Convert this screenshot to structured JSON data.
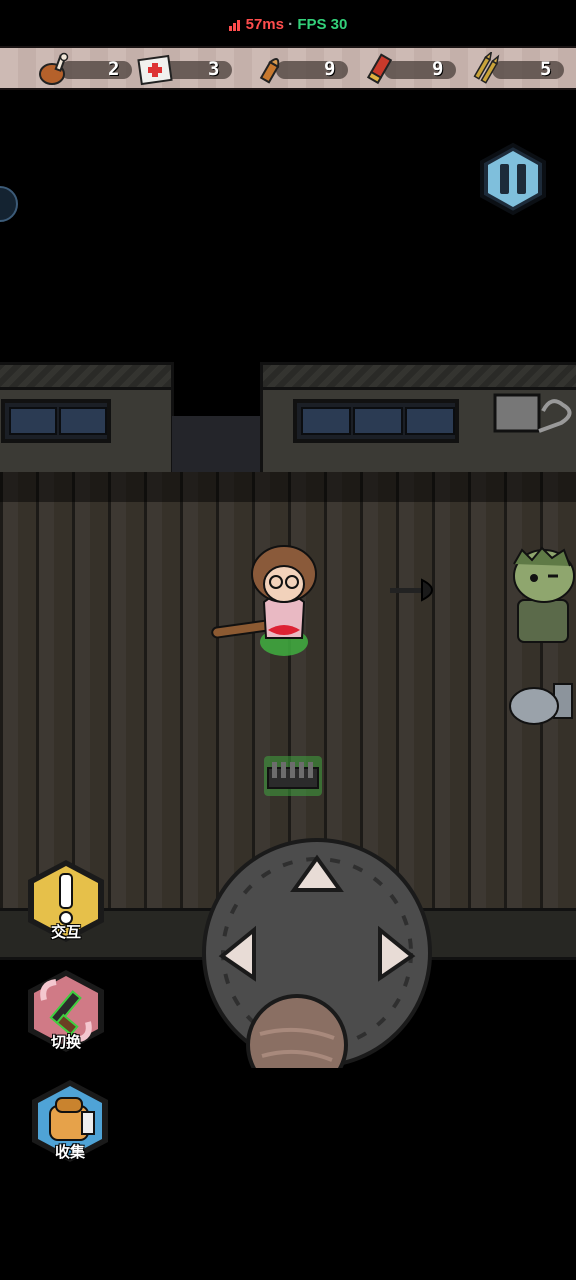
{
  "status": {
    "ping": "57ms",
    "separator": "·",
    "fps": "FPS 30"
  },
  "resources": [
    {
      "name": "food",
      "icon": "chicken-leg-icon",
      "count": "2"
    },
    {
      "name": "medkit",
      "icon": "first-aid-kit-icon",
      "count": "3"
    },
    {
      "name": "pistol-ammo",
      "icon": "bullet-icon",
      "count": "9"
    },
    {
      "name": "shotgun-shells",
      "icon": "shotgun-shell-icon",
      "count": "9"
    },
    {
      "name": "rifle-ammo",
      "icon": "rifle-rounds-icon",
      "count": "5"
    }
  ],
  "actions": {
    "interact": {
      "label": "交互",
      "icon": "exclamation-icon",
      "color": "#e6c04a"
    },
    "switch": {
      "label": "切换",
      "icon": "revolver-icon",
      "color": "#d07a86"
    },
    "collect": {
      "label": "收集",
      "icon": "backpack-icon",
      "color": "#4fa3d6"
    }
  },
  "colors": {
    "ping": "#ff4d4d",
    "fps": "#33d17a",
    "pause": "#7fbfdc"
  }
}
